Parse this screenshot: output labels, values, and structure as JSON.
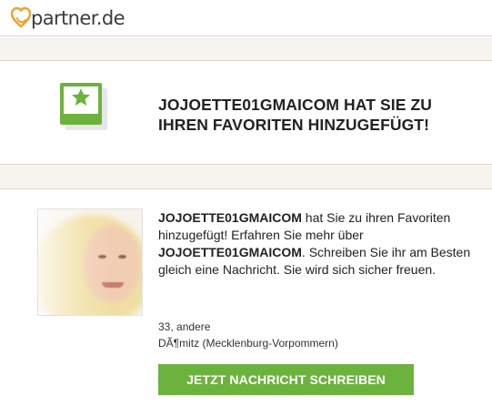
{
  "brand": {
    "logo_text": "partner.de",
    "accent": "#6cb33e",
    "logo_color": "#f5a025"
  },
  "banner": {
    "icon": "favorite-star-icon",
    "title": "JOJOETTE01GMAICOM HAT SIE ZU IHREN FAVORITEN HINZUGEFÜGT!"
  },
  "profile": {
    "photo_alt": "profile-photo",
    "message": {
      "name1": "JOJOETTE01GMAICOM",
      "text1": " hat Sie zu ihren Favoriten hinzugefügt! Erfahren Sie mehr über ",
      "name2": "JOJOETTE01GMAICOM",
      "text2": ". Schreiben Sie ihr am Besten gleich eine Nachricht. Sie wird sich sicher freuen."
    },
    "age_line": "33, andere",
    "location": "DÃ¶mitz (Mecklenburg-Vorpommern)"
  },
  "cta": {
    "label": "JETZT NACHRICHT SCHREIBEN"
  }
}
